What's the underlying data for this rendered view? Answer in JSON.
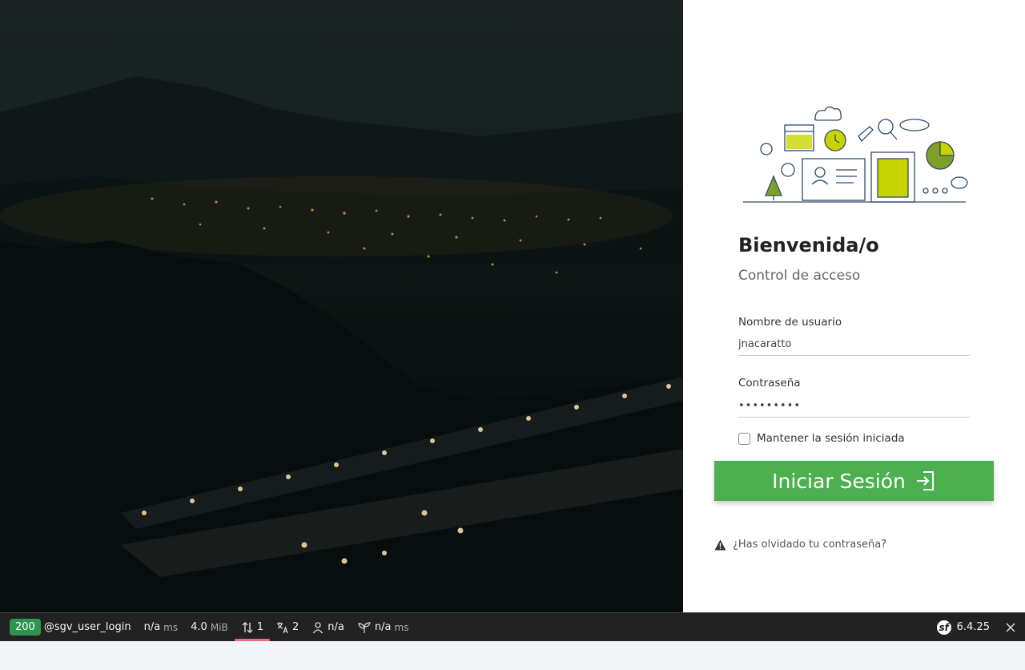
{
  "login": {
    "welcome": "Bienvenida/o",
    "subtitle": "Control de acceso",
    "username_label": "Nombre de usuario",
    "username_value": "jnacaratto",
    "password_label": "Contraseña",
    "password_value": "•••••••••",
    "remember_label": "Mantener la sesión iniciada",
    "submit_label": "Iniciar Sesión",
    "forgot_label": "¿Has olvidado tu contraseña?"
  },
  "toolbar": {
    "status_code": "200",
    "route": "@sgv_user_login",
    "time_value": "n/a",
    "time_unit": "ms",
    "memory_value": "4.0",
    "memory_unit": "MiB",
    "requests_count": "1",
    "translations_count": "2",
    "user_value": "n/a",
    "twig_value": "n/a",
    "twig_unit": "ms",
    "version": "6.4.25"
  },
  "colors": {
    "accent_green": "#4caf50",
    "status_green": "#2e9450",
    "illustration_lime": "#c8d400",
    "illustration_navy": "#2d4a6b"
  }
}
